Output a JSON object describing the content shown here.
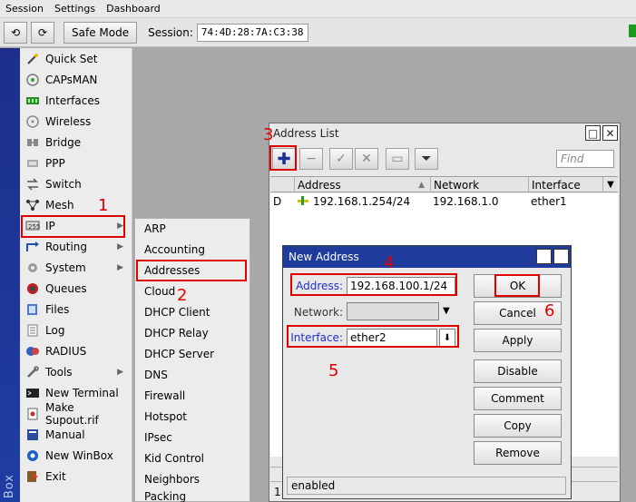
{
  "menubar": {
    "items": [
      "Session",
      "Settings",
      "Dashboard"
    ]
  },
  "toolbar": {
    "undo_glyph": "⟲",
    "redo_glyph": "⟳",
    "safe_mode": "Safe Mode",
    "session_label": "Session:",
    "session_value": "74:4D:28:7A:C3:38"
  },
  "brand": {
    "text": "Box"
  },
  "leftmenu": {
    "items": [
      {
        "label": "Quick Set",
        "icon": "wand-icon"
      },
      {
        "label": "CAPsMAN",
        "icon": "capsman-icon"
      },
      {
        "label": "Interfaces",
        "icon": "interfaces-icon"
      },
      {
        "label": "Wireless",
        "icon": "wireless-icon"
      },
      {
        "label": "Bridge",
        "icon": "bridge-icon"
      },
      {
        "label": "PPP",
        "icon": "ppp-icon"
      },
      {
        "label": "Switch",
        "icon": "switch-icon"
      },
      {
        "label": "Mesh",
        "icon": "mesh-icon"
      },
      {
        "label": "IP",
        "icon": "ip-icon"
      },
      {
        "label": "Routing",
        "icon": "routing-icon"
      },
      {
        "label": "System",
        "icon": "gear-icon"
      },
      {
        "label": "Queues",
        "icon": "queues-icon"
      },
      {
        "label": "Files",
        "icon": "folder-icon"
      },
      {
        "label": "Log",
        "icon": "log-icon"
      },
      {
        "label": "RADIUS",
        "icon": "radius-icon"
      },
      {
        "label": "Tools",
        "icon": "tools-icon"
      },
      {
        "label": "New Terminal",
        "icon": "terminal-icon"
      },
      {
        "label": "Make Supout.rif",
        "icon": "supout-icon"
      },
      {
        "label": "Manual",
        "icon": "book-icon"
      },
      {
        "label": "New WinBox",
        "icon": "winbox-icon"
      },
      {
        "label": "Exit",
        "icon": "exit-icon"
      }
    ]
  },
  "submenu": {
    "items": [
      "ARP",
      "Accounting",
      "Addresses",
      "Cloud",
      "DHCP Client",
      "DHCP Relay",
      "DHCP Server",
      "DNS",
      "Firewall",
      "Hotspot",
      "IPsec",
      "Kid Control",
      "Neighbors",
      "Packing"
    ]
  },
  "steps": [
    "1",
    "2",
    "3",
    "4",
    "5",
    "6"
  ],
  "address_list": {
    "title": "Address List",
    "find_placeholder": "Find",
    "columns": [
      "Address",
      "Network",
      "Interface"
    ],
    "rows": [
      {
        "flag": "D",
        "address": "192.168.1.254/24",
        "network": "192.168.1.0",
        "interface": "ether1"
      }
    ],
    "status_count": "1"
  },
  "new_address": {
    "title": "New Address",
    "address_label": "Address:",
    "address_value": "192.168.100.1/24",
    "network_label": "Network:",
    "network_value": "",
    "interface_label": "Interface:",
    "interface_value": "ether2",
    "buttons": {
      "ok": "OK",
      "cancel": "Cancel",
      "apply": "Apply",
      "disable": "Disable",
      "comment": "Comment",
      "copy": "Copy",
      "remove": "Remove"
    },
    "status": "enabled"
  },
  "colors": {
    "highlight": "#e00000",
    "title_bar": "#1f3b9c",
    "brand_strip": "#1e3da3"
  }
}
